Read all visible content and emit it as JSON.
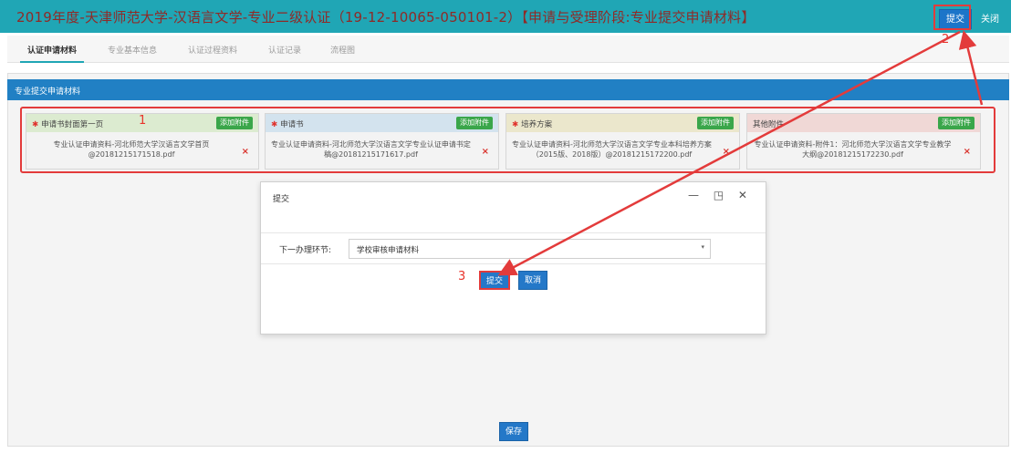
{
  "header": {
    "title": "2019年度-天津师范大学-汉语言文学-专业二级认证（19-12-10065-050101-2）【申请与受理阶段:专业提交申请材料】",
    "submit_label": "提交",
    "close_label": "关闭"
  },
  "tabs": [
    {
      "label": "认证申请材料"
    },
    {
      "label": "专业基本信息"
    },
    {
      "label": "认证过程资料"
    },
    {
      "label": "认证记录"
    },
    {
      "label": "流程图"
    }
  ],
  "panel": {
    "title": "专业提交申请材料"
  },
  "cards": [
    {
      "required": true,
      "title": "申请书封面第一页",
      "add_label": "添加附件",
      "file": "专业认证申请资料-河北师范大学汉语言文学首页@20181215171518.pdf",
      "delete": "×"
    },
    {
      "required": true,
      "title": "申请书",
      "add_label": "添加附件",
      "file": "专业认证申请资料-河北师范大学汉语言文学专业认证申请书定稿@20181215171617.pdf",
      "delete": "×"
    },
    {
      "required": true,
      "title": "培养方案",
      "add_label": "添加附件",
      "file": "专业认证申请资料-河北师范大学汉语言文学专业本科培养方案（2015版、2018版）@20181215172200.pdf",
      "delete": "×"
    },
    {
      "required": false,
      "title": "其他附件",
      "add_label": "添加附件",
      "file": "专业认证申请资料-附件1：河北师范大学汉语言文学专业教学大纲@20181215172230.pdf",
      "delete": "×"
    }
  ],
  "dialog": {
    "title": "提交",
    "controls": "— ◳ ✕",
    "field_label": "下一办理环节:",
    "select_value": "学校审核申请材料",
    "caret": "▾",
    "submit_label": "提交",
    "cancel_label": "取消"
  },
  "footer": {
    "save_label": "保存"
  },
  "annotations": {
    "one": "1",
    "two": "2",
    "three": "3"
  },
  "colors": {
    "topbar": "#20a6b5",
    "title_text": "#8f2a27",
    "primary_button": "#2478c8",
    "annotation": "#e8332b"
  }
}
